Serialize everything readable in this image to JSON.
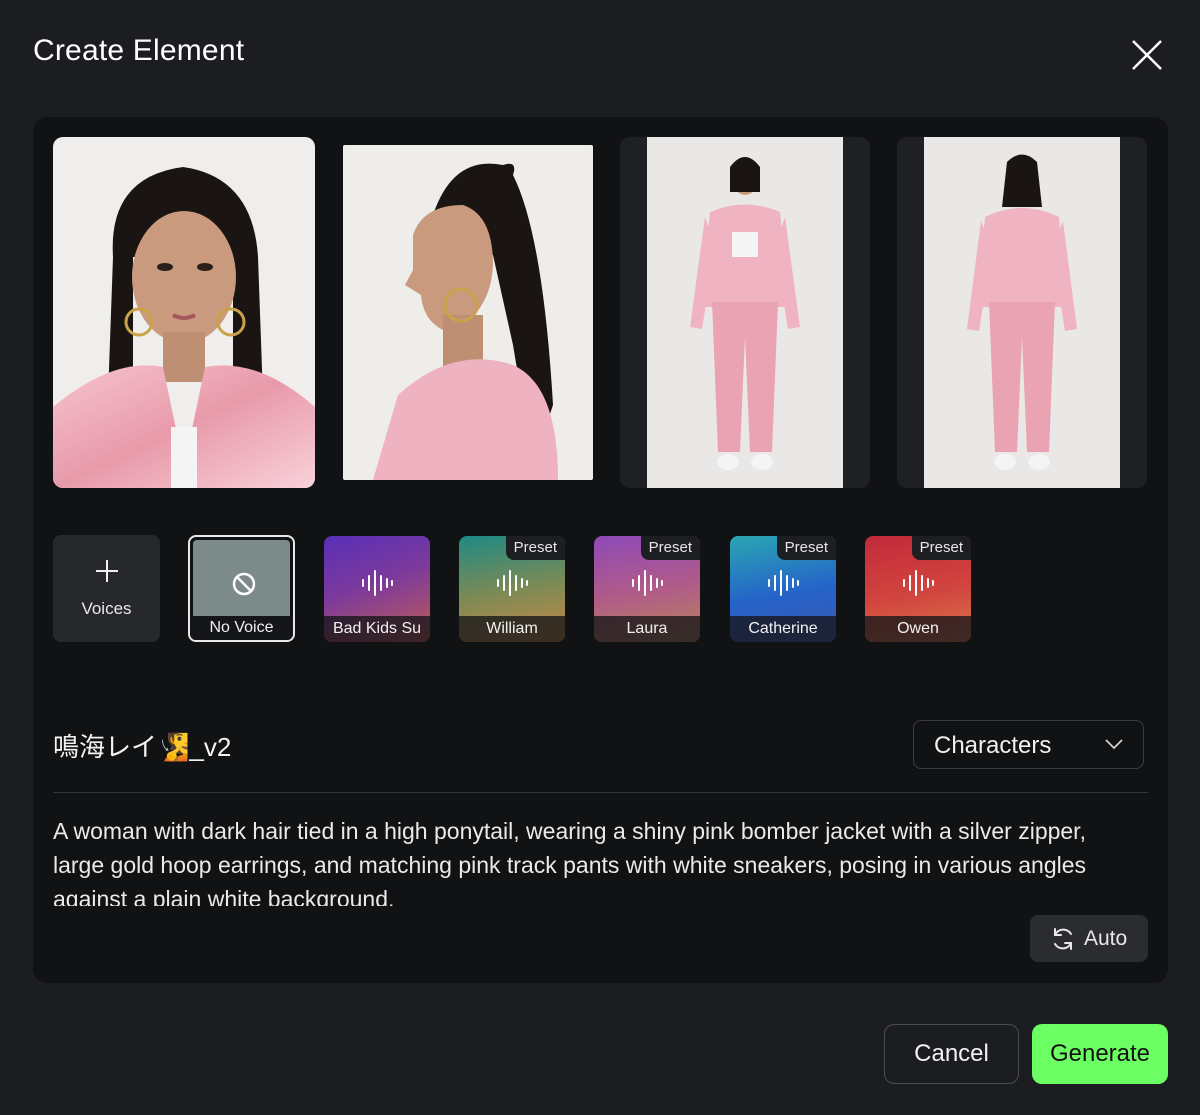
{
  "dialog": {
    "title": "Create Element"
  },
  "images": [
    {
      "name": "front-closeup"
    },
    {
      "name": "side-profile"
    },
    {
      "name": "full-body-front"
    },
    {
      "name": "full-body-back"
    }
  ],
  "voices": {
    "add_label": "Voices",
    "no_voice_label": "No Voice",
    "tiles": [
      {
        "label": "Bad Kids Su",
        "preset": ""
      },
      {
        "label": "William",
        "preset": "Preset"
      },
      {
        "label": "Laura",
        "preset": "Preset"
      },
      {
        "label": "Catherine",
        "preset": "Preset"
      },
      {
        "label": "Owen",
        "preset": "Preset"
      }
    ]
  },
  "element": {
    "name": "鳴海レイ🧏_v2",
    "category": "Characters",
    "description": "A woman with dark hair tied in a high ponytail, wearing a shiny pink bomber jacket with a silver zipper, large gold hoop earrings, and matching pink track pants with white sneakers, posing in various angles against a plain white background.",
    "auto_label": "Auto"
  },
  "footer": {
    "cancel_label": "Cancel",
    "generate_label": "Generate"
  },
  "colors": {
    "accent": "#6cff63",
    "background": "#1c1d21",
    "panel": "#111214"
  }
}
